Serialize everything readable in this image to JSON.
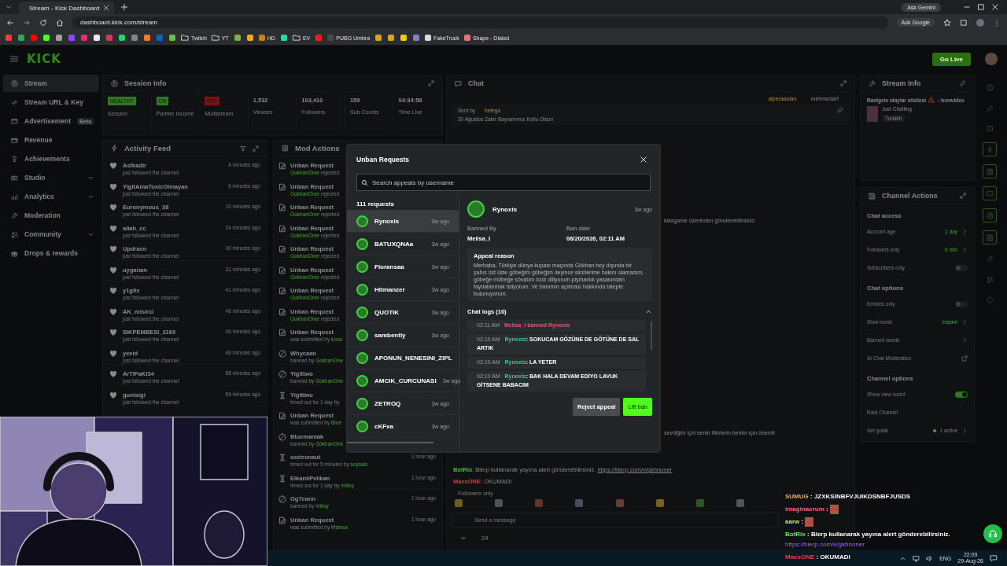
{
  "browser": {
    "tab_title": "Stream - Kick Dashboard",
    "url": "dashboard.kick.com/stream",
    "ask_gemini": "Ask Gemini",
    "ask_google": "Ask Google",
    "bookmarks": [
      {
        "kind": "site",
        "color": "#ea4335"
      },
      {
        "kind": "site",
        "color": "#34a853"
      },
      {
        "kind": "site",
        "color": "#ff0000"
      },
      {
        "kind": "site",
        "color": "#53fc18"
      },
      {
        "kind": "site",
        "color": "#9aa0a6"
      },
      {
        "kind": "site",
        "color": "#9146ff"
      },
      {
        "kind": "site",
        "color": "#e1306c"
      },
      {
        "kind": "site",
        "color": "#e8eaed"
      },
      {
        "kind": "site",
        "color": "#d13a5b"
      },
      {
        "kind": "site",
        "color": "#25d366"
      },
      {
        "kind": "site",
        "color": "#80868b"
      },
      {
        "kind": "site",
        "color": "#f47b20"
      },
      {
        "kind": "site",
        "color": "#0a66c2"
      },
      {
        "kind": "site",
        "color": "#6cc04a"
      },
      {
        "kind": "folder",
        "label": "Twitch"
      },
      {
        "kind": "folder",
        "label": "YT"
      },
      {
        "kind": "site",
        "color": "#7cb342"
      },
      {
        "kind": "site",
        "color": "#f9a825"
      },
      {
        "kind": "site",
        "label": "HD",
        "color": "#c77c2a"
      },
      {
        "kind": "site",
        "color": "#2bd9a0"
      },
      {
        "kind": "folder",
        "label": "EV"
      },
      {
        "kind": "site",
        "color": "#ff1a1a"
      },
      {
        "kind": "site",
        "label": "PUBG Umbra",
        "color": "#4a4a4a"
      },
      {
        "kind": "site",
        "color": "#e0a020"
      },
      {
        "kind": "site",
        "color": "#d4a72c"
      },
      {
        "kind": "site",
        "color": "#f5c518"
      },
      {
        "kind": "site",
        "color": "#8e7cc3"
      },
      {
        "kind": "site",
        "label": "FakeTruck",
        "color": "#dadce0"
      },
      {
        "kind": "site",
        "label": "Shape - Dialed",
        "color": "#e57373"
      }
    ]
  },
  "header": {
    "logo": "KICK",
    "go_live": "Go Live"
  },
  "sidebar": {
    "items": [
      {
        "label": "Stream",
        "selected": true,
        "has_submenu": false
      },
      {
        "label": "Stream URL & Key",
        "selected": false,
        "has_submenu": false
      },
      {
        "label": "Advertisement",
        "badge": "Beta",
        "selected": false,
        "has_submenu": false
      },
      {
        "label": "Revenue",
        "selected": false,
        "has_submenu": false
      },
      {
        "label": "Achievements",
        "selected": false,
        "has_submenu": false
      },
      {
        "label": "Studio",
        "selected": false,
        "has_submenu": true
      },
      {
        "label": "Analytics",
        "selected": false,
        "has_submenu": true
      },
      {
        "label": "Moderation",
        "selected": false,
        "has_submenu": false
      },
      {
        "label": "Community",
        "selected": false,
        "has_submenu": true
      },
      {
        "label": "Drops & rewards",
        "selected": false,
        "has_submenu": false
      }
    ]
  },
  "session_info": {
    "title": "Session Info",
    "stats": [
      {
        "kind": "badge",
        "value": "HEALTHY",
        "color": "#2f7a1f",
        "label": "Session"
      },
      {
        "kind": "badge",
        "value": "ON",
        "color": "#2f7a1f",
        "label": "Partner Income"
      },
      {
        "kind": "badge",
        "value": "OFF",
        "color": "#7a1414",
        "label": "Multistream"
      },
      {
        "kind": "number",
        "value": "1,532",
        "label": "Viewers"
      },
      {
        "kind": "number",
        "value": "103,410",
        "label": "Followers"
      },
      {
        "kind": "number",
        "value": "159",
        "label": "Sub Counts"
      },
      {
        "kind": "number",
        "value": "04:34:58",
        "label": "Time Live"
      }
    ]
  },
  "activity_feed": {
    "title": "Activity Feed",
    "items": [
      {
        "name": "Asfkadir",
        "text": "just followed the channel",
        "time": "4 minutes ago"
      },
      {
        "name": "YigitAmaToxicOlmayan",
        "text": "just followed the channel",
        "time": "6 minutes ago"
      },
      {
        "name": "Euronymous_38",
        "text": "just followed the channel",
        "time": "10 minutes ago"
      },
      {
        "name": "aliah_cc",
        "text": "just followed the channel",
        "time": "24 minutes ago"
      },
      {
        "name": "Updraen",
        "text": "just followed the channel",
        "time": "30 minutes ago"
      },
      {
        "name": "uygaram",
        "text": "just followed the channel",
        "time": "31 minutes ago"
      },
      {
        "name": "y1gitx",
        "text": "just followed the channel",
        "time": "41 minutes ago"
      },
      {
        "name": "AK_misirci",
        "text": "just followed the channel",
        "time": "46 minutes ago"
      },
      {
        "name": "SIKPEMBESI_3169",
        "text": "just followed the channel",
        "time": "46 minutes ago"
      },
      {
        "name": "yeeid",
        "text": "just followed the channel",
        "time": "48 minutes ago"
      },
      {
        "name": "ArTiFaKt34",
        "text": "just followed the channel",
        "time": "58 minutes ago"
      },
      {
        "name": "gunisigi",
        "text": "just followed the channel",
        "time": "59 minutes ago"
      }
    ]
  },
  "mod_actions": {
    "title": "Mod Actions",
    "items": [
      {
        "kind": "rejected",
        "title": "Unban Request",
        "user": "GokhanOner",
        "text": "rejected"
      },
      {
        "kind": "rejected",
        "title": "Unban Request",
        "user": "GokhanOner",
        "text": "rejected"
      },
      {
        "kind": "rejected",
        "title": "Unban Request",
        "user": "GokhanOner",
        "text": "rejected"
      },
      {
        "kind": "rejected",
        "title": "Unban Request",
        "user": "GokhanOner",
        "text": "rejected"
      },
      {
        "kind": "rejected",
        "title": "Unban Request",
        "user": "GokhanOner",
        "text": "rejected"
      },
      {
        "kind": "rejected",
        "title": "Unban Request",
        "user": "GokhanOner",
        "text": "rejected"
      },
      {
        "kind": "rejected",
        "title": "Unban Request",
        "user": "GokhanOner",
        "text": "rejected"
      },
      {
        "kind": "rejected",
        "title": "Unban Request",
        "user": "GokhanOner",
        "text": "rejected"
      },
      {
        "kind": "submitted",
        "title": "Unban Request",
        "text": "was submitted by",
        "user": "koza"
      },
      {
        "kind": "banned",
        "title": "Whycaan",
        "text": "banned by",
        "user": "GokhanOne"
      },
      {
        "kind": "banned",
        "title": "Yigittwo",
        "text": "banned by",
        "user": "GokhanOne"
      },
      {
        "kind": "timeout",
        "title": "Yigittwo",
        "text": "timed out for 1 day by"
      },
      {
        "kind": "submitted",
        "title": "Unban Request",
        "text": "was submitted by",
        "user": "Blue"
      },
      {
        "kind": "banned",
        "title": "Bluemaniak",
        "text": "banned by",
        "user": "GokhanOne"
      },
      {
        "kind": "timeout",
        "title": "sextronaut",
        "text": "timed out for 5 minutes by",
        "user": "soysals",
        "time": "1 hour ago"
      },
      {
        "kind": "timeout",
        "title": "ElkanliPelikan",
        "text": "timed out for 1 day by",
        "user": "milloy",
        "time": "1 hour ago"
      },
      {
        "kind": "banned",
        "title": "Og7cann",
        "text": "banned by",
        "user": "milloy",
        "time": "1 hour ago"
      },
      {
        "kind": "submitted",
        "title": "Unban Request",
        "text": "was submitted by",
        "user": "Metnox",
        "time": "1 hour ago"
      }
    ]
  },
  "chat": {
    "title": "Chat",
    "pinned_users": [
      "alperaaslan",
      "mehmedarf"
    ],
    "pinned": {
      "sent_by": "Sent by",
      "author": "befega",
      "text": "30 Ağustos Zafer Bayramımız Kutlu Olsun"
    },
    "fragments": [
      "klasgame üzerinden gönderebilirsiniz.",
      "sevdiğim için senin fikirlerin benim için önemli"
    ],
    "messages": [
      {
        "user": "BotRix",
        "color": "#3fbf3f",
        "text": ": Blerp kullanarak yayına alert gönderebilirsiniz.",
        "link": "https://blerp.com/x/gkhnoner"
      },
      {
        "user": "MaesONE",
        "color": "#d23a4a",
        "text": ": OKUMADI"
      }
    ],
    "followers_only": "Followers only",
    "input_placeholder": "Send a message",
    "footer": [
      "∞",
      "24"
    ]
  },
  "stream_info": {
    "title": "Stream Info",
    "stream_title": "Rastgele olaylar silsilesi",
    "stream_title_suffix": "- !sonvideo",
    "category": "Just Chatting",
    "tag": "Turkish"
  },
  "channel_actions": {
    "title": "Channel Actions",
    "sections": [
      {
        "title": "Chat access",
        "rows": [
          {
            "kind": "value",
            "label": "Account age",
            "value": "1 day"
          },
          {
            "kind": "value",
            "label": "Followers only",
            "value": "6 min"
          },
          {
            "kind": "toggle",
            "label": "Subscribers only",
            "on": false
          }
        ]
      },
      {
        "title": "Chat options",
        "rows": [
          {
            "kind": "toggle",
            "label": "Emotes only",
            "on": false
          },
          {
            "kind": "value",
            "label": "Slow mode",
            "value": "Instant"
          },
          {
            "kind": "link",
            "label": "Banned words"
          },
          {
            "kind": "external",
            "label": "AI Chat Moderation"
          }
        ]
      },
      {
        "title": "Channel options",
        "rows": [
          {
            "kind": "toggle",
            "label": "Show view count",
            "on": true
          },
          {
            "kind": "plain",
            "label": "Raid Channel"
          },
          {
            "kind": "status",
            "label": "Set goals",
            "value": "1 active"
          }
        ]
      }
    ]
  },
  "modal": {
    "title": "Unban Requests",
    "search_placeholder": "Search appeals by username",
    "count": "111 requests",
    "requests": [
      {
        "name": "Rynoxis",
        "time": "3w ago",
        "selected": true
      },
      {
        "name": "BATUXQNAa",
        "time": "3w ago",
        "selected": false
      },
      {
        "name": "Floransaa",
        "time": "3w ago",
        "selected": false
      },
      {
        "name": "Hitmanzer",
        "time": "3w ago",
        "selected": false
      },
      {
        "name": "QUOTIK",
        "time": "3w ago",
        "selected": false
      },
      {
        "name": "sambently",
        "time": "3w ago",
        "selected": false
      },
      {
        "name": "APONUN_NENESINI_ZIPL",
        "selected": false
      },
      {
        "name": "AMCIK_CURCUNASI",
        "time": "3w ago",
        "selected": false
      },
      {
        "name": "ZETROQ",
        "time": "3w ago",
        "selected": false
      },
      {
        "name": "cKFxa",
        "time": "3w ago",
        "selected": false
      }
    ],
    "detail": {
      "name": "Rynoxis",
      "time": "3w ago",
      "banned_by_label": "Banned By",
      "banned_by": "Melisa_I",
      "ban_date_label": "Ban date",
      "ban_date": "06/20/2026, 02:11 AM",
      "appeal_title": "Appeal reason",
      "appeal_text": "Merhaba, Türkiye dünya kupası maçında Gökhan bey dışında bir şahıs üst üste göbeğim göbeğim deyince sinirlerime hakim olamadım, göbeğe möbeğe sövdüm özür diliyorum pişmanlık yasasından faydalanmak istiyorum. Ve banımın açılması hakkında talepte bulunuyorum.",
      "logs_title": "Chat logs (10)",
      "logs": [
        {
          "kind": "ban",
          "time": "02:11 AM",
          "text": "Melisa_I banned Rynoxis"
        },
        {
          "kind": "message",
          "time": "02:10 AM",
          "user": "Rynoxis",
          "text": ": SOKUCAM GÖZÜNE DE GÖTÜNE DE SAL ARTIK"
        },
        {
          "kind": "message",
          "time": "02:10 AM",
          "user": "Rynoxis",
          "text": ": LA YETER"
        },
        {
          "kind": "message",
          "time": "02:10 AM",
          "user": "Rynoxis",
          "text": ": BAK HALA DEVAM EDİYO LAVUK GİTSENE BABACIM"
        }
      ]
    },
    "buttons": {
      "reject": "Reject appeal",
      "lift": "Lift ban"
    }
  },
  "overlay_chat": [
    {
      "user": "SUMUG",
      "color": "#f0b070",
      "text": ": JZXKSINBFVJUIKDSNBFJUSDS"
    },
    {
      "user": "imaginaerum",
      "color": "#ff6b8b",
      "text": ":",
      "emote": true
    },
    {
      "user": "aarw",
      "color": "#c8f050",
      "text": ":",
      "emote": true
    },
    {
      "user": "BotRix",
      "color": "#5ef05e",
      "text": ": Blerp kullanarak yayına alert gönderebilirsiniz.",
      "link": "https://blerp.com/x/gkhnoner"
    },
    {
      "user": "MaesONE",
      "color": "#ff3a5a",
      "text": ": OKUMADI"
    }
  ],
  "taskbar": {
    "language": "ENG",
    "time": "22:09",
    "date": "29-Aug-26"
  }
}
